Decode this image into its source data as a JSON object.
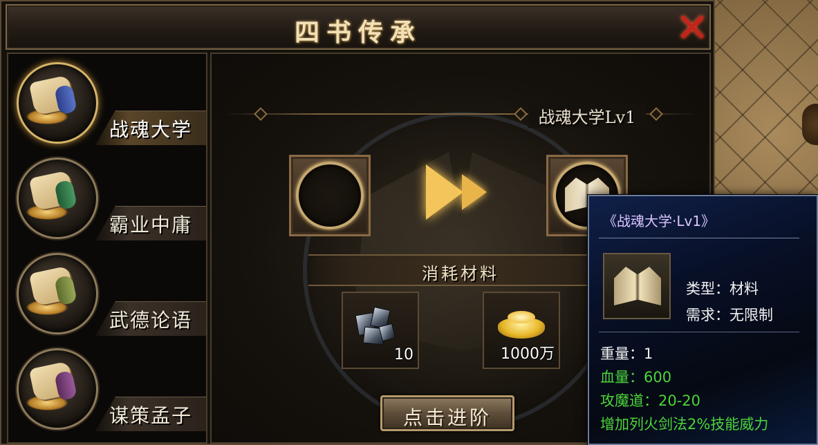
{
  "window": {
    "title": "四书传承",
    "close_icon": "close-x-icon"
  },
  "tabs": [
    {
      "label": "战魂大学",
      "icon": "scroll-icon",
      "active": true
    },
    {
      "label": "霸业中庸",
      "icon": "scroll-icon",
      "active": false
    },
    {
      "label": "武德论语",
      "icon": "scroll-icon",
      "active": false
    },
    {
      "label": "谋策孟子",
      "icon": "scroll-icon",
      "active": false
    }
  ],
  "main": {
    "level_title": "战魂大学Lv1",
    "consume_label": "消耗材料",
    "materials": [
      {
        "icon": "ore-icon",
        "qty": "10"
      },
      {
        "icon": "gold-ingot-icon",
        "qty": "1000万"
      }
    ],
    "advance_button": "点击进阶"
  },
  "tooltip": {
    "name": "《战魂大学·Lv1》",
    "type_row": "类型：材料",
    "requirement_row": "需求：无限制",
    "weight_row": "重量：1",
    "hp_row": "血量：600",
    "attack_row": "攻魔道：20-20",
    "skill_row": "增加列火剑法2%技能威力"
  },
  "colors": {
    "accent_gold": "#d7b46a",
    "tooltip_green": "#4cd53a",
    "tooltip_name": "#d9c5ff",
    "close_red": "#c4241c"
  }
}
